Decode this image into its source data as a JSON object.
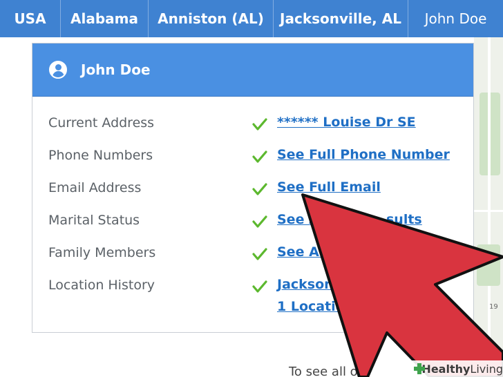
{
  "breadcrumb": [
    "USA",
    "Alabama",
    "Anniston (AL)",
    "Jacksonville, AL",
    "John Doe"
  ],
  "card": {
    "title": "John Doe",
    "rows": [
      {
        "label": "Current Address",
        "link": "****** Louise Dr SE",
        "link2": ""
      },
      {
        "label": "Phone Numbers",
        "link": "See Full Phone Number",
        "link2": ""
      },
      {
        "label": "Email Address",
        "link": "See Full Email",
        "link2": ""
      },
      {
        "label": "Marital Status",
        "link": "See A",
        "link2": "sults"
      },
      {
        "label": "Family Members",
        "link": "See Ava",
        "link2": ""
      },
      {
        "label": "Location History",
        "link": "Jacksonvi",
        "link2": "1 Location"
      }
    ]
  },
  "footer": {
    "text": "To see all of"
  },
  "map": {
    "label": "19"
  },
  "watermark": {
    "brand_bold": "Healthy",
    "brand_rest": " Living"
  },
  "colors": {
    "header_blue": "#3f82d1",
    "card_blue": "#4a90e2",
    "link": "#1f6fc5",
    "check": "#5cb82e",
    "arrow": "#d9343f"
  }
}
